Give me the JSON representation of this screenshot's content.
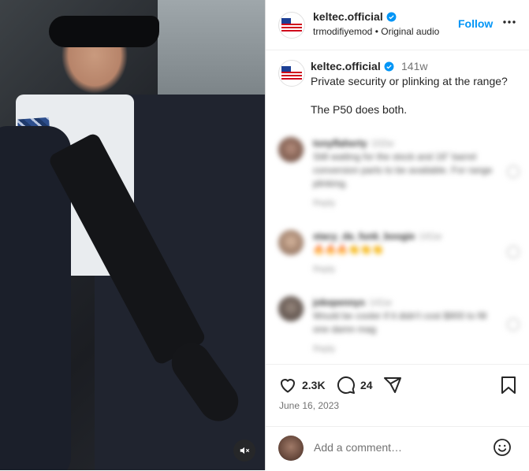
{
  "header": {
    "username": "keltec.official",
    "sub_user": "trmodifiyemod",
    "sub_sep": "•",
    "sub_audio": "Original audio",
    "follow_label": "Follow"
  },
  "caption": {
    "username": "keltec.official",
    "time": "141w",
    "text": "Private security or plinking at the range?\n\nThe P50 does both."
  },
  "comments": [
    {
      "user": "tonyflaherty",
      "time": "102w",
      "text": "Still waiting for the stock and 16\" barrel conversion parts to be available. For range plinking.",
      "reply": "Reply"
    },
    {
      "user": "stacy_da_funk_boogie",
      "time": "141w",
      "text": "🔥🔥🔥👏👏👏",
      "reply": "Reply"
    },
    {
      "user": "jokepennys",
      "time": "141w",
      "text": "Would be cooler if it didn't cost $900 to fill one damn mag",
      "reply": "Reply"
    }
  ],
  "actions": {
    "likes": "2.3K",
    "comments": "24",
    "date": "June 16, 2023"
  },
  "add_comment": {
    "placeholder": "Add a comment…"
  },
  "icons": {
    "verified": "verified-badge-icon",
    "more": "more-icon",
    "heart": "heart-icon",
    "comment": "comment-icon",
    "share": "share-icon",
    "save": "bookmark-icon",
    "emoji": "emoji-icon",
    "mute": "mute-icon"
  },
  "colors": {
    "accent": "#0095f6",
    "verified": "#0095f6",
    "muted": "#737373"
  }
}
